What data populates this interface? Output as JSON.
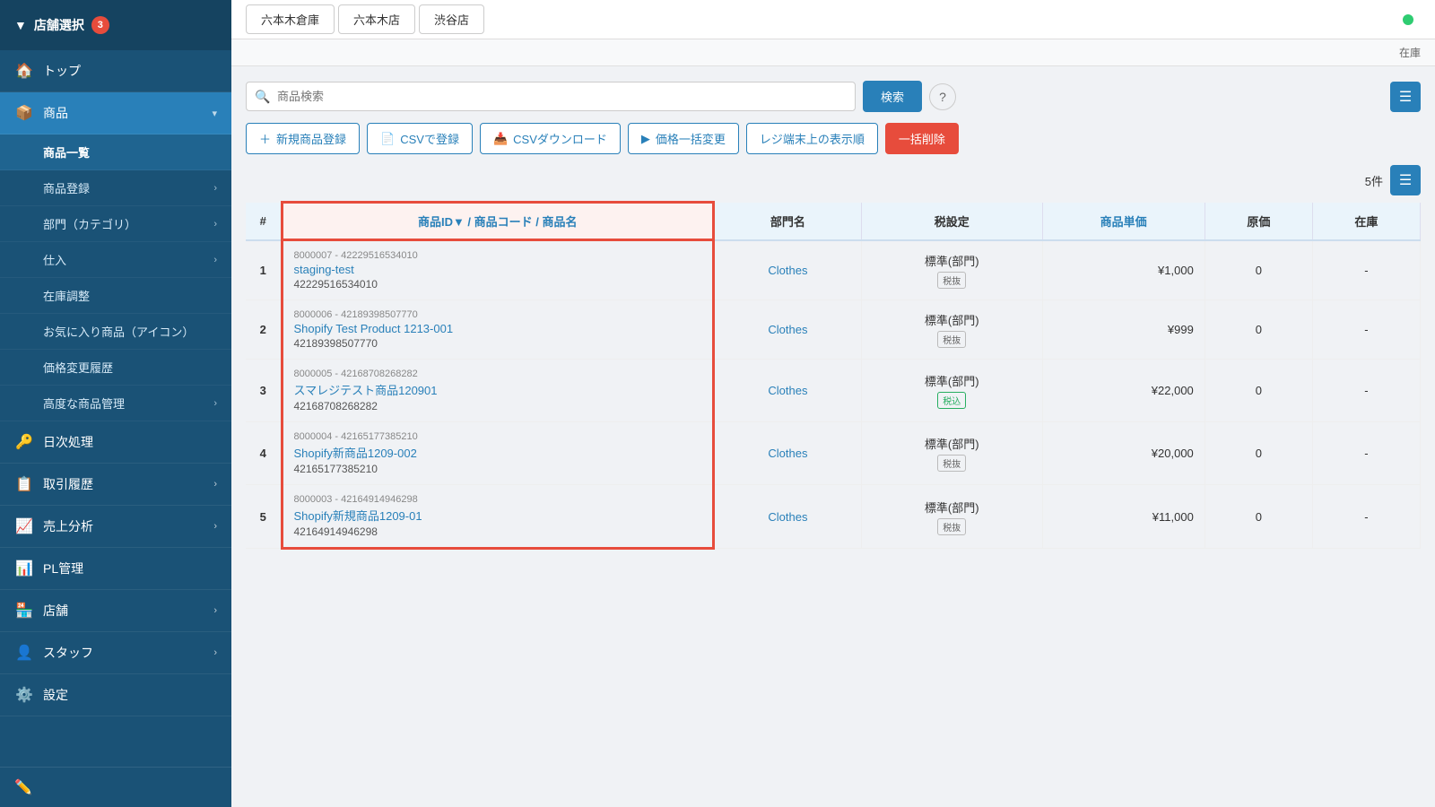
{
  "sidebar": {
    "store_selector_label": "店舗選択",
    "store_badge": "3",
    "items": [
      {
        "id": "top",
        "icon": "🏠",
        "label": "トップ",
        "active": false,
        "has_sub": false
      },
      {
        "id": "products",
        "icon": "📦",
        "label": "商品",
        "active": true,
        "has_sub": true
      },
      {
        "id": "daily",
        "icon": "🔑",
        "label": "日次処理",
        "active": false,
        "has_sub": false
      },
      {
        "id": "history",
        "icon": "📋",
        "label": "取引履歴",
        "active": false,
        "has_sub": true
      },
      {
        "id": "sales",
        "icon": "📈",
        "label": "売上分析",
        "active": false,
        "has_sub": true
      },
      {
        "id": "pl",
        "icon": "📊",
        "label": "PL管理",
        "active": false,
        "has_sub": false
      },
      {
        "id": "store",
        "icon": "🏪",
        "label": "店舗",
        "active": false,
        "has_sub": true
      },
      {
        "id": "staff",
        "icon": "👤",
        "label": "スタッフ",
        "active": false,
        "has_sub": true
      },
      {
        "id": "settings",
        "icon": "⚙️",
        "label": "設定",
        "active": false,
        "has_sub": false
      }
    ],
    "sub_items": [
      {
        "label": "商品一覧",
        "active": true
      },
      {
        "label": "商品登録",
        "has_arrow": true
      },
      {
        "label": "部門（カテゴリ）",
        "has_arrow": true
      },
      {
        "label": "仕入",
        "has_arrow": true
      },
      {
        "label": "在庫調整"
      },
      {
        "label": "お気に入り商品（アイコン）"
      },
      {
        "label": "価格変更履歴"
      },
      {
        "label": "高度な商品管理",
        "has_arrow": true
      }
    ]
  },
  "tabs": [
    {
      "label": "六本木倉庫"
    },
    {
      "label": "六本木店"
    },
    {
      "label": "渋谷店"
    }
  ],
  "header": {
    "stock_label": "在庫"
  },
  "search": {
    "placeholder": "商品検索",
    "button_label": "検索"
  },
  "actions": [
    {
      "id": "new",
      "icon": "+",
      "label": "新規商品登録"
    },
    {
      "id": "csv-register",
      "icon": "📄",
      "label": "CSVで登録"
    },
    {
      "id": "csv-download",
      "icon": "📥",
      "label": "CSVダウンロード"
    },
    {
      "id": "price-change",
      "icon": "▶",
      "label": "価格一括変更"
    },
    {
      "id": "register-order",
      "icon": "",
      "label": "レジ端末上の表示順"
    },
    {
      "id": "bulk-delete",
      "icon": "",
      "label": "一括削除",
      "danger": true
    }
  ],
  "table": {
    "count": "5件",
    "columns": [
      {
        "label": "商品ID▼ / 商品コード / 商品名",
        "link": true
      },
      {
        "label": "部門名"
      },
      {
        "label": "税設定"
      },
      {
        "label": "商品単価",
        "link": true
      },
      {
        "label": "原価"
      },
      {
        "label": "在庫"
      }
    ],
    "rows": [
      {
        "num": 1,
        "product_id": "8000007 - 42229516534010",
        "product_link": "staging-test",
        "product_code": "42229516534010",
        "dept": "Clothes",
        "tax": "標準(部門)",
        "tax_badge": "税抜",
        "tax_badge_type": "normal",
        "price": "¥1,000",
        "cost": "0",
        "stock": "-"
      },
      {
        "num": 2,
        "product_id": "8000006 - 42189398507770",
        "product_link": "Shopify Test Product 1213-001",
        "product_code": "42189398507770",
        "dept": "Clothes",
        "tax": "標準(部門)",
        "tax_badge": "税抜",
        "tax_badge_type": "normal",
        "price": "¥999",
        "cost": "0",
        "stock": "-"
      },
      {
        "num": 3,
        "product_id": "8000005 - 42168708268282",
        "product_link": "スマレジテスト商品120901",
        "product_code": "42168708268282",
        "dept": "Clothes",
        "tax": "標準(部門)",
        "tax_badge": "税込",
        "tax_badge_type": "green",
        "price": "¥22,000",
        "cost": "0",
        "stock": "-"
      },
      {
        "num": 4,
        "product_id": "8000004 - 42165177385210",
        "product_link": "Shopify新商品1209-002",
        "product_code": "42165177385210",
        "dept": "Clothes",
        "tax": "標準(部門)",
        "tax_badge": "税抜",
        "tax_badge_type": "normal",
        "price": "¥20,000",
        "cost": "0",
        "stock": "-"
      },
      {
        "num": 5,
        "product_id": "8000003 - 42164914946298",
        "product_link": "Shopify新規商品1209-01",
        "product_code": "42164914946298",
        "dept": "Clothes",
        "tax": "標準(部門)",
        "tax_badge": "税抜",
        "tax_badge_type": "normal",
        "price": "¥11,000",
        "cost": "0",
        "stock": "-"
      }
    ]
  }
}
